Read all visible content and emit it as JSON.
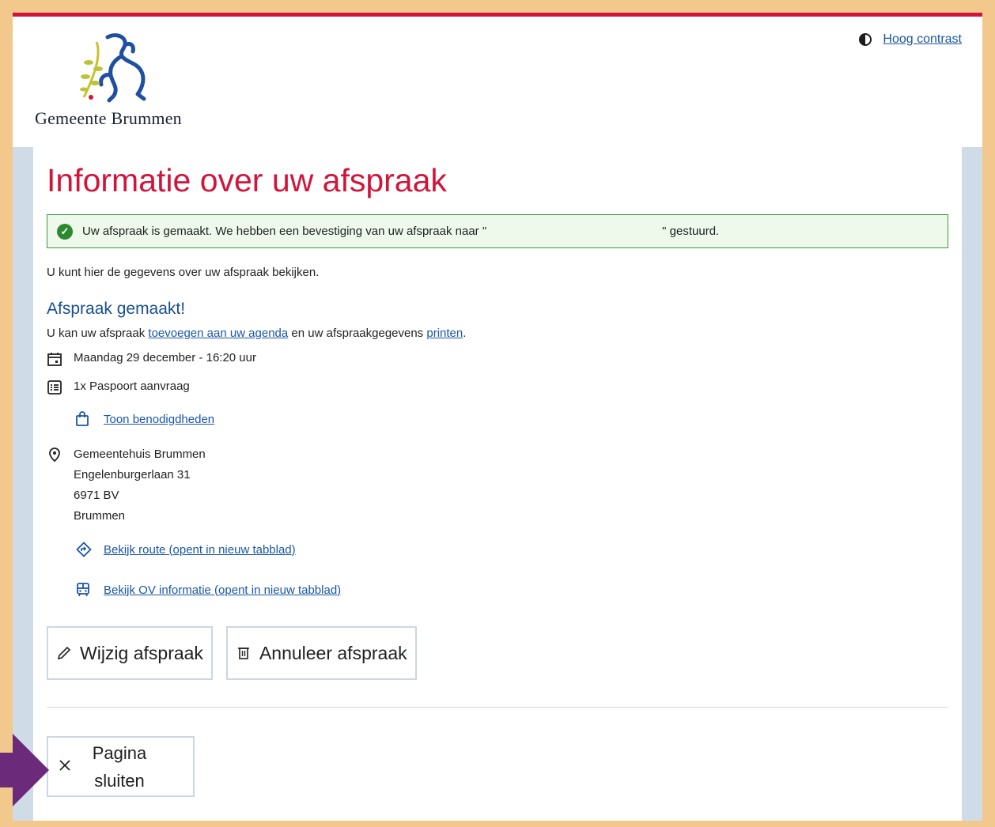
{
  "header": {
    "logo_text": "Gemeente Brummen",
    "contrast_label": "Hoog contrast"
  },
  "main": {
    "title": "Informatie over uw afspraak",
    "alert_before": "Uw afspraak is gemaakt. We hebben een bevestiging van uw afspraak naar \"",
    "alert_after": "\" gestuurd.",
    "intro": "U kunt hier de gegevens over uw afspraak bekijken.",
    "subtitle": "Afspraak gemaakt!",
    "agenda_prefix": "U kan uw afspraak ",
    "agenda_link": "toevoegen aan uw agenda",
    "agenda_middle": " en uw afspraakgegevens ",
    "print_link": "printen",
    "agenda_suffix": ".",
    "datetime": "Maandag 29 december - 16:20 uur",
    "product": "1x Paspoort aanvraag",
    "requirements_link": "Toon benodigdheden",
    "location": {
      "name": "Gemeentehuis Brummen",
      "street": "Engelenburgerlaan 31",
      "postcode": "6971 BV",
      "city": "Brummen"
    },
    "route_link": "Bekijk route (opent in nieuw tabblad)",
    "ov_link": "Bekijk OV informatie (opent in nieuw tabblad)",
    "edit_button": "Wijzig afspraak",
    "cancel_button": "Annuleer afspraak",
    "close_line1": "Pagina",
    "close_line2": "sluiten"
  },
  "colors": {
    "accent_red": "#d2143a",
    "link_blue": "#1a56a6",
    "success_green": "#2b8a2f",
    "frame_orange": "#f3c88c",
    "arrow_purple": "#6b2a7a"
  }
}
